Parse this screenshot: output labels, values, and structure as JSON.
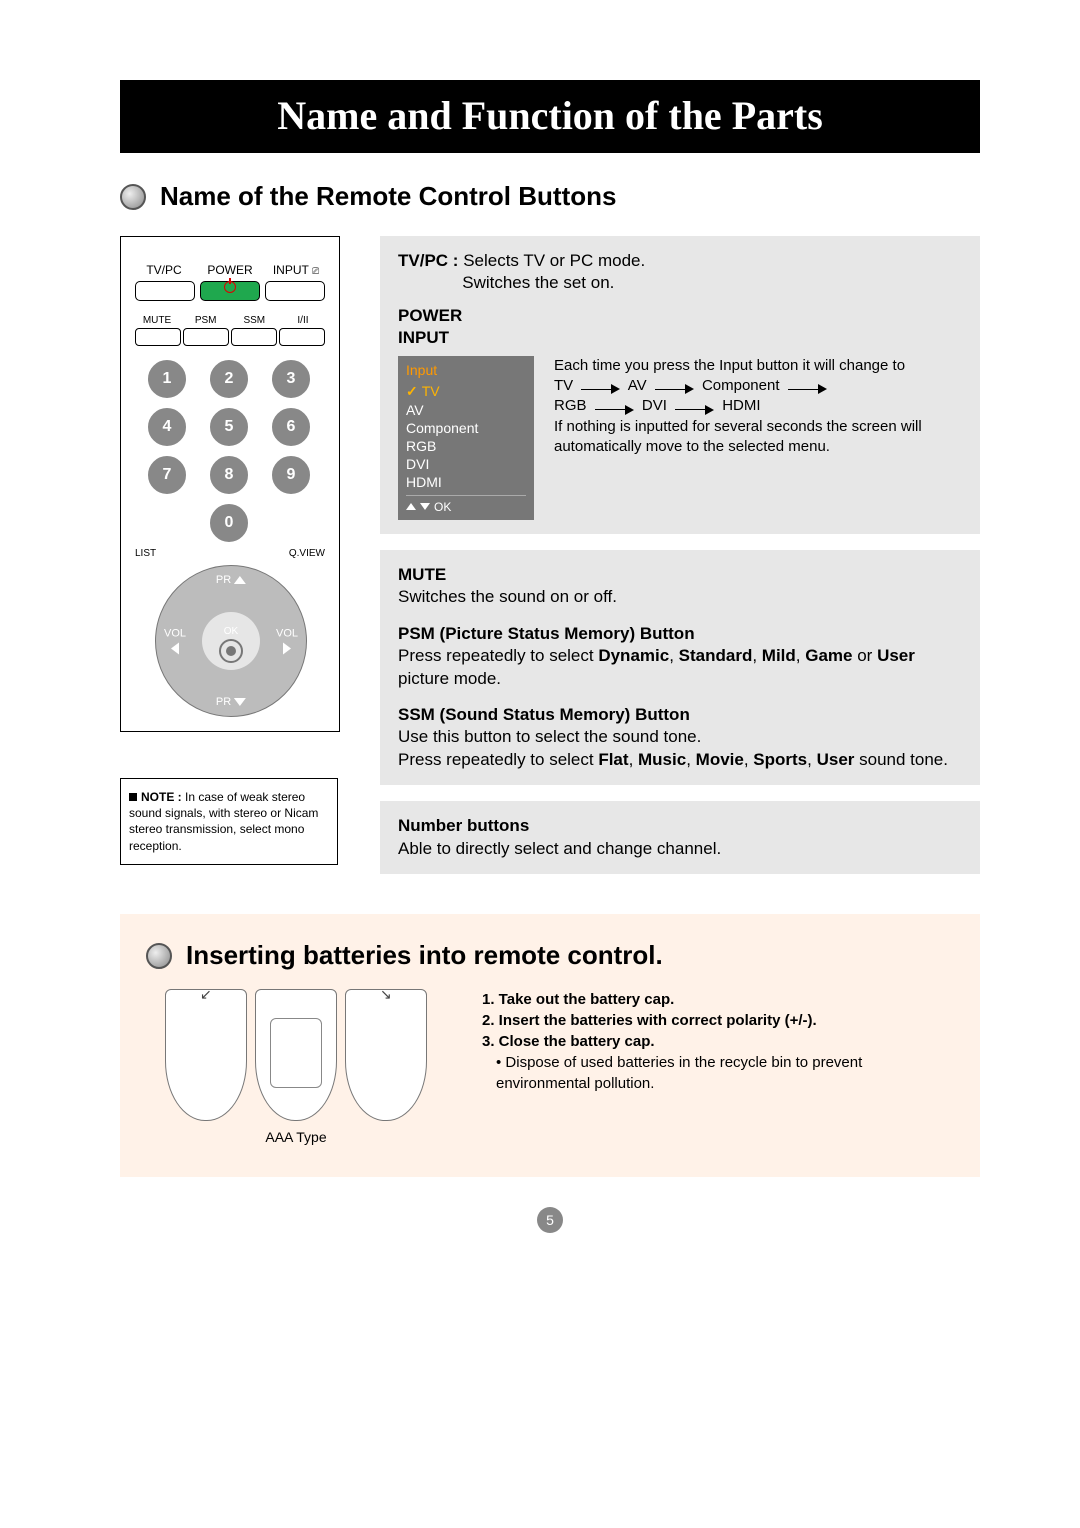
{
  "page_title": "Name and Function of the Parts",
  "section1_title": "Name of the Remote Control Buttons",
  "remote": {
    "row1": {
      "tvpc": "TV/PC",
      "power": "POWER",
      "input": "INPUT",
      "input_sym": "⎚"
    },
    "row2": {
      "mute": "MUTE",
      "mute_sym": "🔇",
      "psm": "PSM",
      "ssm": "SSM",
      "i_ii": "I/II"
    },
    "keys": [
      "1",
      "2",
      "3",
      "4",
      "5",
      "6",
      "7",
      "8",
      "9",
      "",
      "0",
      ""
    ],
    "list": "LIST",
    "qview": "Q.VIEW",
    "pr": "PR",
    "vol": "VOL",
    "ok": "OK"
  },
  "note": {
    "label": "NOTE :",
    "text": "In case of weak stereo sound signals, with stereo or Nicam stereo transmission, select mono reception."
  },
  "tvpc": {
    "label": "TV/PC :",
    "line1": "Selects TV or PC mode.",
    "line2": "Switches the set on."
  },
  "power_label": "POWER",
  "input_label": "INPUT",
  "input_menu": {
    "title": "Input",
    "items": [
      "TV",
      "AV",
      "Component",
      "RGB",
      "DVI",
      "HDMI"
    ],
    "ok": "OK"
  },
  "input_desc_1": "Each time you press the Input button it will change to",
  "input_cycle": [
    "TV",
    "AV",
    "Component",
    "RGB",
    "DVI",
    "HDMI"
  ],
  "input_desc_2": "If nothing is inputted for several seconds the screen will automatically move to the selected menu.",
  "mute": {
    "title": "MUTE",
    "text": "Switches the sound on or off."
  },
  "psm": {
    "title": "PSM (Picture Status Memory) Button",
    "prefix": "Press repeatedly to select ",
    "opts": [
      "Dynamic",
      "Standard",
      "Mild",
      "Game",
      "User"
    ],
    "suffix": " picture mode."
  },
  "ssm": {
    "title": "SSM (Sound Status Memory) Button",
    "line1": "Use this button to select the sound tone.",
    "prefix": "Press repeatedly to select ",
    "opts": [
      "Flat",
      "Music",
      "Movie",
      "Sports",
      "User"
    ],
    "suffix": " sound tone."
  },
  "numbtn": {
    "title": "Number buttons",
    "text": "Able to directly select and change channel."
  },
  "section2_title": "Inserting batteries into remote control.",
  "aaa_type": "AAA Type",
  "steps": {
    "s1": "1. Take out the battery cap.",
    "s2": "2. Insert the batteries with correct polarity (+/-).",
    "s3": "3. Close the battery cap.",
    "bullet": "• Dispose of used batteries in the recycle bin to prevent environmental pollution."
  },
  "page_number": "5"
}
